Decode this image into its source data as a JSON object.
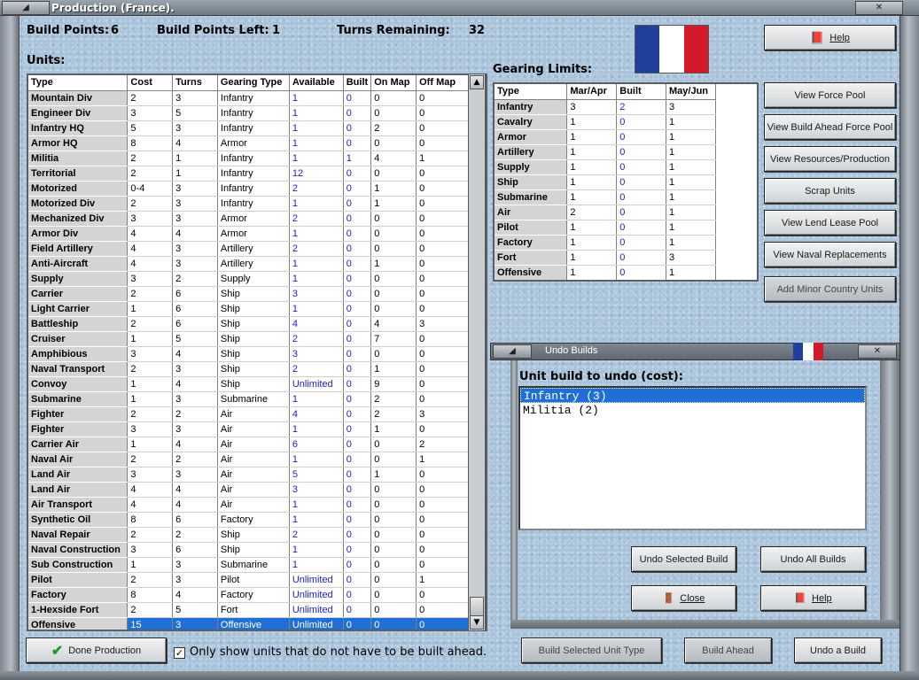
{
  "window": {
    "title": "Production (France)."
  },
  "stats": {
    "build_points_label": "Build Points:",
    "build_points": "6",
    "build_points_left_label": "Build Points Left:",
    "build_points_left": "1",
    "turns_remaining_label": "Turns Remaining:",
    "turns_remaining": "32"
  },
  "flag_colors": [
    "#1f3f9a",
    "#ffffff",
    "#d31a2a"
  ],
  "units": {
    "heading": "Units:",
    "columns": [
      "Type",
      "Cost",
      "Turns",
      "Gearing Type",
      "Available",
      "Built",
      "On Map",
      "Off Map"
    ],
    "rows": [
      [
        "Mountain Div",
        "2",
        "3",
        "Infantry",
        "1",
        "0",
        "0",
        "0"
      ],
      [
        "Engineer Div",
        "3",
        "5",
        "Infantry",
        "1",
        "0",
        "0",
        "0"
      ],
      [
        "Infantry HQ",
        "5",
        "3",
        "Infantry",
        "1",
        "0",
        "2",
        "0"
      ],
      [
        "Armor HQ",
        "8",
        "4",
        "Armor",
        "1",
        "0",
        "0",
        "0"
      ],
      [
        "Militia",
        "2",
        "1",
        "Infantry",
        "1",
        "1",
        "4",
        "1"
      ],
      [
        "Territorial",
        "2",
        "1",
        "Infantry",
        "12",
        "0",
        "0",
        "0"
      ],
      [
        "Motorized",
        "0-4",
        "3",
        "Infantry",
        "2",
        "0",
        "1",
        "0"
      ],
      [
        "Motorized Div",
        "2",
        "3",
        "Infantry",
        "1",
        "0",
        "1",
        "0"
      ],
      [
        "Mechanized Div",
        "3",
        "3",
        "Armor",
        "2",
        "0",
        "0",
        "0"
      ],
      [
        "Armor Div",
        "4",
        "4",
        "Armor",
        "1",
        "0",
        "0",
        "0"
      ],
      [
        "Field Artillery",
        "4",
        "3",
        "Artillery",
        "2",
        "0",
        "0",
        "0"
      ],
      [
        "Anti-Aircraft",
        "4",
        "3",
        "Artillery",
        "1",
        "0",
        "1",
        "0"
      ],
      [
        "Supply",
        "3",
        "2",
        "Supply",
        "1",
        "0",
        "0",
        "0"
      ],
      [
        "Carrier",
        "2",
        "6",
        "Ship",
        "3",
        "0",
        "0",
        "0"
      ],
      [
        "Light Carrier",
        "1",
        "6",
        "Ship",
        "1",
        "0",
        "0",
        "0"
      ],
      [
        "Battleship",
        "2",
        "6",
        "Ship",
        "4",
        "0",
        "4",
        "3"
      ],
      [
        "Cruiser",
        "1",
        "5",
        "Ship",
        "2",
        "0",
        "7",
        "0"
      ],
      [
        "Amphibious",
        "3",
        "4",
        "Ship",
        "3",
        "0",
        "0",
        "0"
      ],
      [
        "Naval Transport",
        "2",
        "3",
        "Ship",
        "2",
        "0",
        "1",
        "0"
      ],
      [
        "Convoy",
        "1",
        "4",
        "Ship",
        "Unlimited",
        "0",
        "9",
        "0"
      ],
      [
        "Submarine",
        "1",
        "3",
        "Submarine",
        "1",
        "0",
        "2",
        "0"
      ],
      [
        "Fighter",
        "2",
        "2",
        "Air",
        "4",
        "0",
        "2",
        "3"
      ],
      [
        "Fighter",
        "3",
        "3",
        "Air",
        "1",
        "0",
        "1",
        "0"
      ],
      [
        "Carrier Air",
        "1",
        "4",
        "Air",
        "6",
        "0",
        "0",
        "2"
      ],
      [
        "Naval Air",
        "2",
        "2",
        "Air",
        "1",
        "0",
        "0",
        "1"
      ],
      [
        "Land Air",
        "3",
        "3",
        "Air",
        "5",
        "0",
        "1",
        "0"
      ],
      [
        "Land Air",
        "4",
        "4",
        "Air",
        "3",
        "0",
        "0",
        "0"
      ],
      [
        "Air Transport",
        "4",
        "4",
        "Air",
        "1",
        "0",
        "0",
        "0"
      ],
      [
        "Synthetic Oil",
        "8",
        "6",
        "Factory",
        "1",
        "0",
        "0",
        "0"
      ],
      [
        "Naval Repair",
        "2",
        "2",
        "Ship",
        "2",
        "0",
        "0",
        "0"
      ],
      [
        "Naval Construction",
        "3",
        "6",
        "Ship",
        "1",
        "0",
        "0",
        "0"
      ],
      [
        "Sub Construction",
        "1",
        "3",
        "Submarine",
        "1",
        "0",
        "0",
        "0"
      ],
      [
        "Pilot",
        "2",
        "3",
        "Pilot",
        "Unlimited",
        "0",
        "0",
        "1"
      ],
      [
        "Factory",
        "8",
        "4",
        "Factory",
        "Unlimited",
        "0",
        "0",
        "0"
      ],
      [
        "1-Hexside Fort",
        "2",
        "5",
        "Fort",
        "Unlimited",
        "0",
        "0",
        "0"
      ],
      [
        "Offensive",
        "15",
        "3",
        "Offensive",
        "Unlimited",
        "0",
        "0",
        "0"
      ]
    ],
    "selected_row": 35
  },
  "gearing": {
    "heading": "Gearing Limits:",
    "columns": [
      "Type",
      "Mar/Apr",
      "Built",
      "May/Jun"
    ],
    "rows": [
      [
        "Infantry",
        "3",
        "2",
        "3"
      ],
      [
        "Cavalry",
        "1",
        "0",
        "1"
      ],
      [
        "Armor",
        "1",
        "0",
        "1"
      ],
      [
        "Artillery",
        "1",
        "0",
        "1"
      ],
      [
        "Supply",
        "1",
        "0",
        "1"
      ],
      [
        "Ship",
        "1",
        "0",
        "1"
      ],
      [
        "Submarine",
        "1",
        "0",
        "1"
      ],
      [
        "Air",
        "2",
        "0",
        "1"
      ],
      [
        "Pilot",
        "1",
        "0",
        "1"
      ],
      [
        "Factory",
        "1",
        "0",
        "1"
      ],
      [
        "Fort",
        "1",
        "0",
        "3"
      ],
      [
        "Offensive",
        "1",
        "0",
        "1"
      ]
    ]
  },
  "right_buttons": {
    "help": "Help",
    "view_force_pool": "View Force Pool",
    "view_build_ahead": "View Build Ahead Force Pool",
    "view_resources": "View Resources/Production",
    "scrap_units": "Scrap Units",
    "view_lend_lease": "View Lend Lease Pool",
    "view_naval_repl": "View Naval Replacements",
    "add_minor": "Add Minor Country Units"
  },
  "undo_panel": {
    "title": "Undo Builds",
    "list_label": "Unit build to undo (cost):",
    "items": [
      "Infantry (3)",
      "Militia (2)"
    ],
    "undo_selected": "Undo Selected Build",
    "undo_all": "Undo All Builds",
    "close": "Close",
    "help": "Help"
  },
  "bottom": {
    "done": "Done Production",
    "checkbox_label": "Only show units that do not have to be built ahead.",
    "checkbox_checked": "✓",
    "build_selected": "Build Selected Unit Type",
    "build_ahead": "Build Ahead",
    "undo_build": "Undo a Build"
  }
}
